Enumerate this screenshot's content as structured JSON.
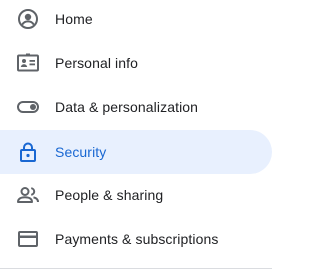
{
  "sidebar": {
    "items": [
      {
        "label": "Home",
        "icon": "account-circle-icon",
        "active": false
      },
      {
        "label": "Personal info",
        "icon": "id-card-icon",
        "active": false
      },
      {
        "label": "Data & personalization",
        "icon": "toggle-icon",
        "active": false
      },
      {
        "label": "Security",
        "icon": "lock-icon",
        "active": true
      },
      {
        "label": "People & sharing",
        "icon": "people-icon",
        "active": false
      },
      {
        "label": "Payments & subscriptions",
        "icon": "credit-card-icon",
        "active": false
      }
    ]
  },
  "colors": {
    "active_background": "#e8f0fe",
    "active_text": "#1967d2",
    "text": "#202124",
    "icon": "#5f6368"
  }
}
